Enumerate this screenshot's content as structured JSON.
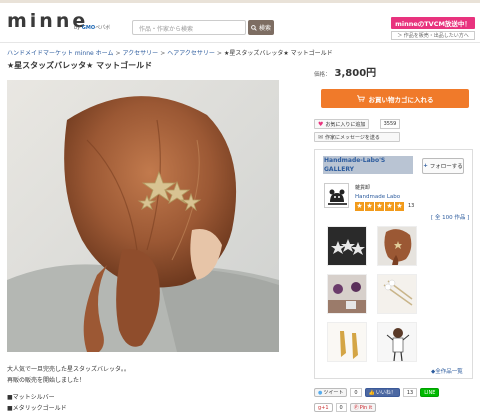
{
  "header": {
    "logo": "minne",
    "logo_sub_prefix": "by",
    "logo_sub_brand": "GMO",
    "logo_sub_suffix": "ペパボ",
    "search_placeholder": "作品・作家から検索",
    "search_button": "検索",
    "tvcm": "minneのTVCM放送中！",
    "sell_link": "＞ 作品を販売・出品したい方へ"
  },
  "breadcrumb": {
    "items": [
      "ハンドメイドマーケット minne ホーム",
      "アクセサリー",
      "ヘアアクセサリー"
    ],
    "separator": ">",
    "current": "★星スタッズバレッタ★ マットゴールド"
  },
  "product": {
    "title": "★星スタッズバレッタ★ マットゴールド",
    "price_label": "価格：",
    "price": "3,800円",
    "cart_button": "お買い物カゴに入れる",
    "favorite_button": "お気に入りに追加",
    "favorite_count": "3559",
    "message_button": "作家にメッセージを送る",
    "description": [
      "大人気で一旦完売した星スタッズバレッタ。。",
      "再販の販売を開始しました！",
      "",
      "■マットシルバー",
      "■メタリックゴールド"
    ]
  },
  "gallery": {
    "name": "Handmade-Labo'S GALLERY",
    "follow_button": "フォローする",
    "author_label": "雑貨卸",
    "author_name": "Handmade Labo",
    "rating": 5,
    "review_count": "13",
    "all_items": "[ 全 100 作品 ]",
    "list_link": "◆全作品一覧"
  },
  "social": {
    "tweet": "ツイート",
    "tweet_count": "0",
    "like": "いいね！",
    "like_count": "13",
    "line": "LINE",
    "gplus": "g+1",
    "gplus_count": "0",
    "pin": "Pin it"
  },
  "colors": {
    "accent_orange": "#f07a2a",
    "accent_pink": "#e8337e",
    "link_blue": "#2d5c9e",
    "star_orange": "#f29a1a"
  }
}
